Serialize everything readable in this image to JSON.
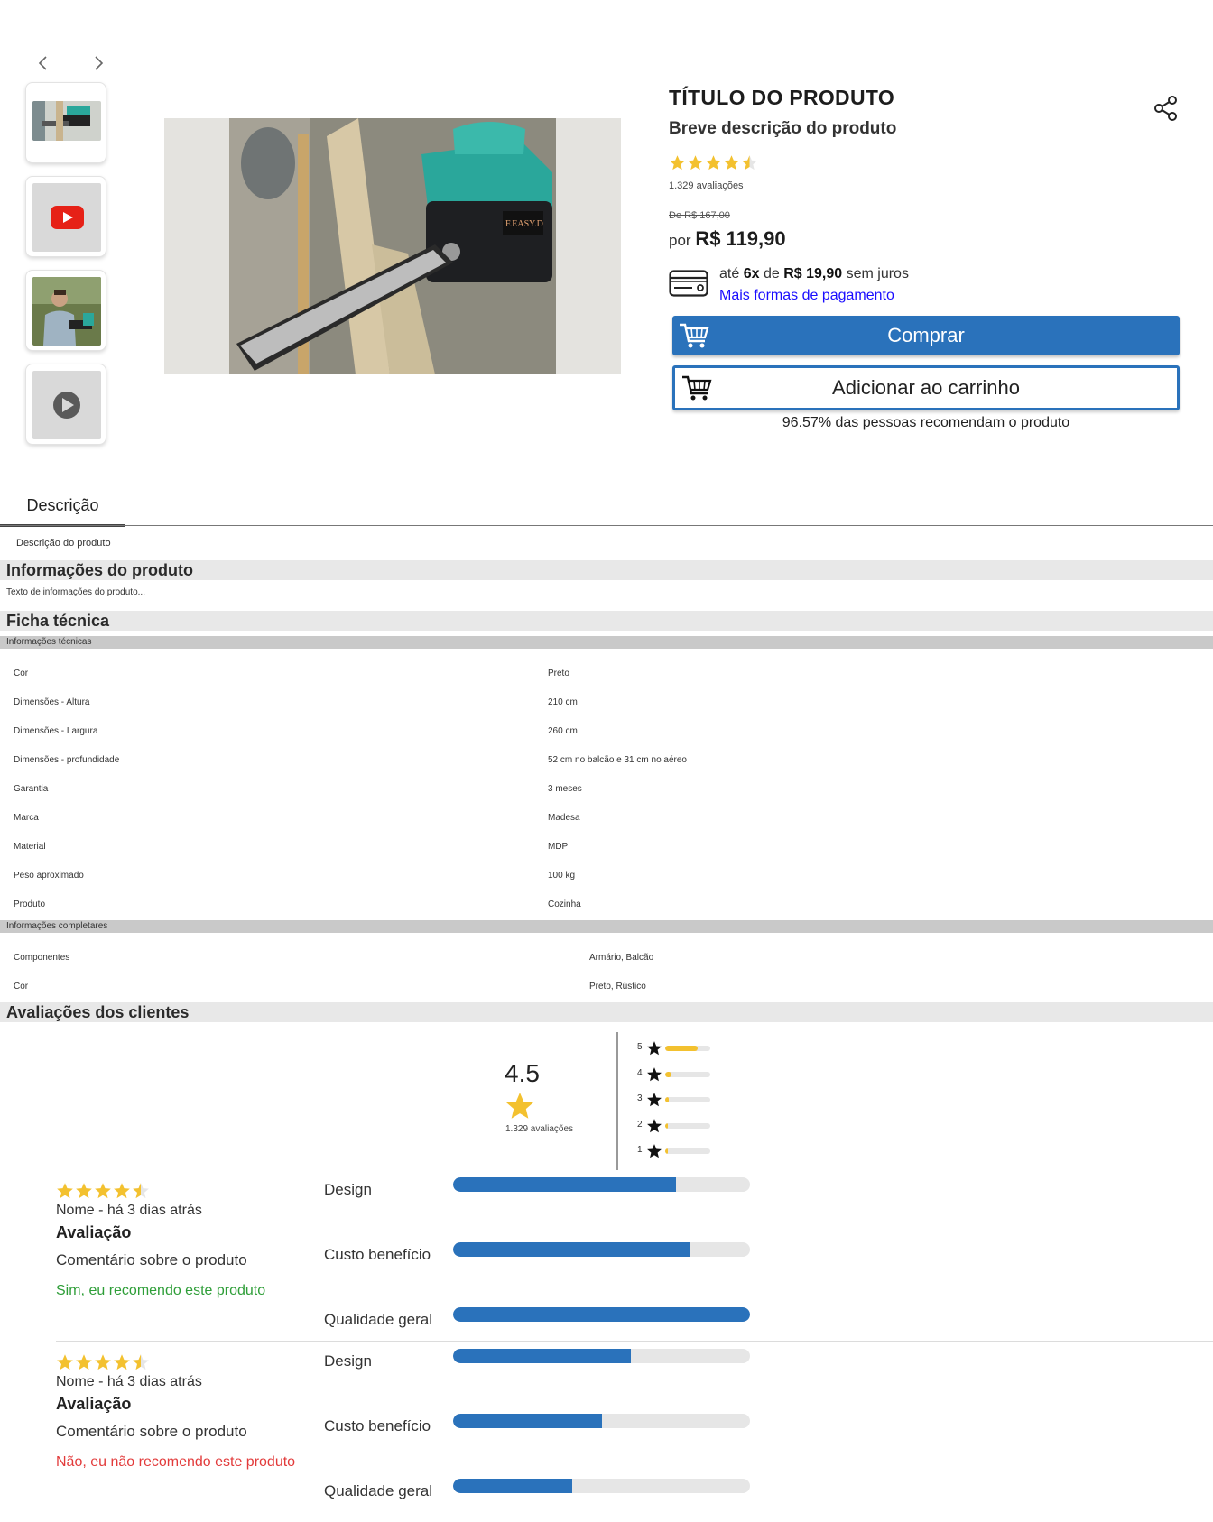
{
  "colors": {
    "accent": "#2a72bb",
    "star": "#f3c12f",
    "recommend_yes": "#2e9e38",
    "recommend_no": "#e23b3b",
    "link": "#1a0dff"
  },
  "gallery": {
    "thumbnails": [
      {
        "type": "image",
        "icon": "chainsaw-thumbnail"
      },
      {
        "type": "video",
        "icon": "youtube-icon"
      },
      {
        "type": "image",
        "icon": "person-thumbnail"
      },
      {
        "type": "video",
        "icon": "play-icon"
      }
    ],
    "main_image_brand": "F.EASY.D"
  },
  "product": {
    "title": "TÍTULO DO PRODUTO",
    "subtitle": "Breve descrição do produto",
    "rating": 4.5,
    "review_count": "1.329 avaliações",
    "old_price": "De R$ 167,00",
    "price_prefix": "por",
    "price": "R$ 119,90",
    "installments_prefix": "até",
    "installments_count": "6x",
    "installments_mid": "de",
    "installments_value": "R$ 19,90",
    "installments_suffix": "sem juros",
    "more_payments": "Mais formas de pagamento",
    "buy_label": "Comprar",
    "cart_label": "Adicionar ao carrinho",
    "recommend_pct": "96.57% das pessoas recomendam o produto"
  },
  "tabs": {
    "description": "Descrição"
  },
  "description": {
    "text": "Descrição do produto"
  },
  "info": {
    "title": "Informações do produto",
    "text": "Texto de informações do produto..."
  },
  "tech": {
    "title": "Ficha técnica",
    "section1_title": "Informações técnicas",
    "section1_rows": [
      {
        "k": "Cor",
        "v": "Preto"
      },
      {
        "k": "Dimensões - Altura",
        "v": "210 cm"
      },
      {
        "k": "Dimensões - Largura",
        "v": "260 cm"
      },
      {
        "k": "Dimensões - profundidade",
        "v": "52 cm no balcão e 31 cm no aéreo"
      },
      {
        "k": "Garantia",
        "v": "3 meses"
      },
      {
        "k": "Marca",
        "v": "Madesa"
      },
      {
        "k": "Material",
        "v": "MDP"
      },
      {
        "k": "Peso aproximado",
        "v": "100 kg"
      },
      {
        "k": "Produto",
        "v": "Cozinha"
      }
    ],
    "section2_title": "Informações completares",
    "section2_rows": [
      {
        "k": "Componentes",
        "v": "Armário, Balcão"
      },
      {
        "k": "Cor",
        "v": "Preto, Rústico"
      }
    ]
  },
  "reviews": {
    "title": "Avaliações dos clientes",
    "average": "4.5",
    "count": "1.329 avaliações",
    "distribution": [
      {
        "stars": "5",
        "fraction": 0.72
      },
      {
        "stars": "4",
        "fraction": 0.14
      },
      {
        "stars": "3",
        "fraction": 0.08
      },
      {
        "stars": "2",
        "fraction": 0.06
      },
      {
        "stars": "1",
        "fraction": 0.06
      }
    ],
    "items": [
      {
        "rating": 4.5,
        "name": "Nome - há 3 dias atrás",
        "title": "Avaliação",
        "comment": "Comentário sobre o produto",
        "recommend": "Sim, eu recomendo este produto",
        "recommends": true,
        "criteria": [
          {
            "label": "Design",
            "fraction": 0.75
          },
          {
            "label": "Custo benefício",
            "fraction": 0.8
          },
          {
            "label": "Qualidade geral",
            "fraction": 1.0
          }
        ]
      },
      {
        "rating": 4.5,
        "name": "Nome - há 3 dias atrás",
        "title": "Avaliação",
        "comment": "Comentário sobre o produto",
        "recommend": "Não, eu não recomendo este produto",
        "recommends": false,
        "criteria": [
          {
            "label": "Design",
            "fraction": 0.6
          },
          {
            "label": "Custo benefício",
            "fraction": 0.5
          },
          {
            "label": "Qualidade geral",
            "fraction": 0.4
          }
        ]
      }
    ]
  }
}
